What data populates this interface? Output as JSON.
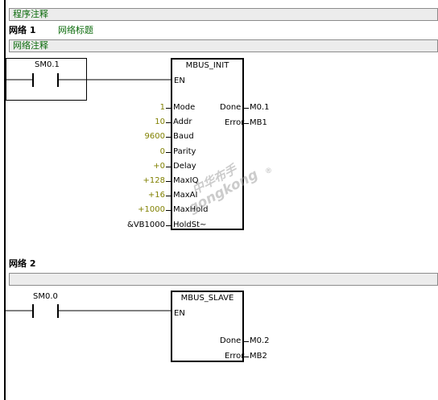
{
  "program_comment": "程序注释",
  "network1": {
    "label": "网络 1",
    "title": "网络标题",
    "comment": "网络注释",
    "contact": "SM0.1",
    "block": {
      "name": "MBUS_INIT",
      "en": "EN",
      "inputs": [
        {
          "value": "1",
          "pin": "Mode"
        },
        {
          "value": "10",
          "pin": "Addr"
        },
        {
          "value": "9600",
          "pin": "Baud"
        },
        {
          "value": "0",
          "pin": "Parity"
        },
        {
          "value": "+0",
          "pin": "Delay"
        },
        {
          "value": "+128",
          "pin": "MaxIQ"
        },
        {
          "value": "+16",
          "pin": "MaxAI"
        },
        {
          "value": "+1000",
          "pin": "MaxHold"
        },
        {
          "value": "&VB1000",
          "pin": "HoldSt~"
        }
      ],
      "outputs": [
        {
          "pin": "Done",
          "value": "M0.1"
        },
        {
          "pin": "Error",
          "value": "MB1"
        }
      ]
    }
  },
  "network2": {
    "label": "网络 2",
    "contact": "SM0.0",
    "block": {
      "name": "MBUS_SLAVE",
      "en": "EN",
      "outputs": [
        {
          "pin": "Done",
          "value": "M0.2"
        },
        {
          "pin": "Error",
          "value": "MB2"
        }
      ]
    }
  },
  "watermark": {
    "cn": "中华布手",
    "en": "gongkong",
    "reg": "®"
  }
}
